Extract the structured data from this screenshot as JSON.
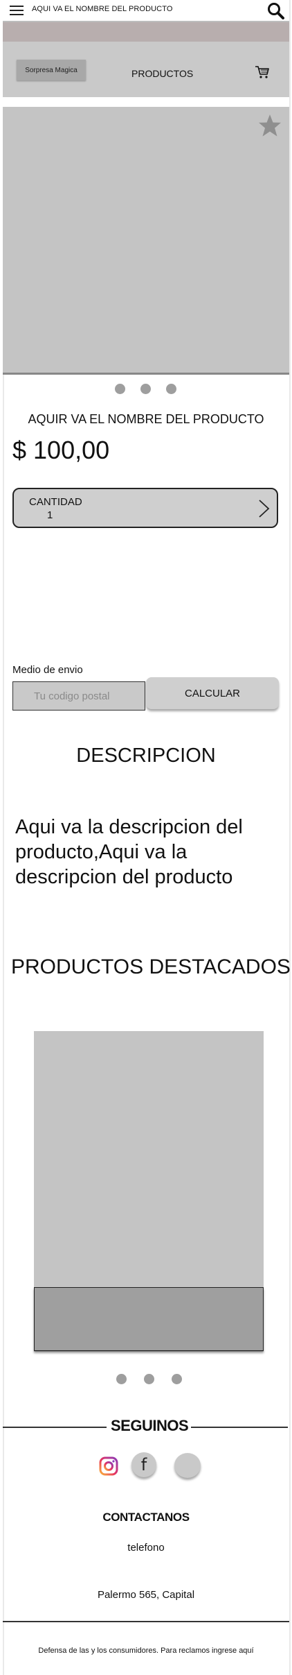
{
  "topbar": {
    "title": "AQUI VA EL NOMBRE DEL PRODUCTO",
    "menu_icon": "hamburger-icon",
    "search_icon": "search-icon"
  },
  "header": {
    "sorpresa_label": "Sorpresa Magica",
    "productos_label": "PRODUCTOS",
    "cart_icon": "cart-icon"
  },
  "product": {
    "favorite_icon": "star-icon",
    "name": "AQUIR VA EL NOMBRE DEL PRODUCTO",
    "price": "$ 100,00",
    "quantity_label": "CANTIDAD",
    "quantity_value": "1"
  },
  "shipping": {
    "label": "Medio de envio",
    "postal_placeholder": "Tu codigo postal",
    "calculate_label": "CALCULAR"
  },
  "description": {
    "title": "DESCRIPCION",
    "text": "Aqui va la descripcion del producto,Aqui va la descripcion del producto"
  },
  "featured": {
    "title": "PRODUCTOS DESTACADOS"
  },
  "footer": {
    "seguinos": "SEGUINOS",
    "social_icons": [
      "instagram-icon",
      "facebook-icon",
      "social-icon"
    ],
    "facebook_glyph": "f",
    "contactanos": "CONTACTANOS",
    "telefono": "telefono",
    "direccion": "Palermo 565, Capital",
    "defensa": "Defensa de las y los consumidores. Para reclamos ingrese aquí"
  },
  "colors": {
    "band": "#b8aeae",
    "header_bg": "#c9c9c9",
    "image_placeholder": "#c4c4c4",
    "dots": "#9e9e9e"
  }
}
